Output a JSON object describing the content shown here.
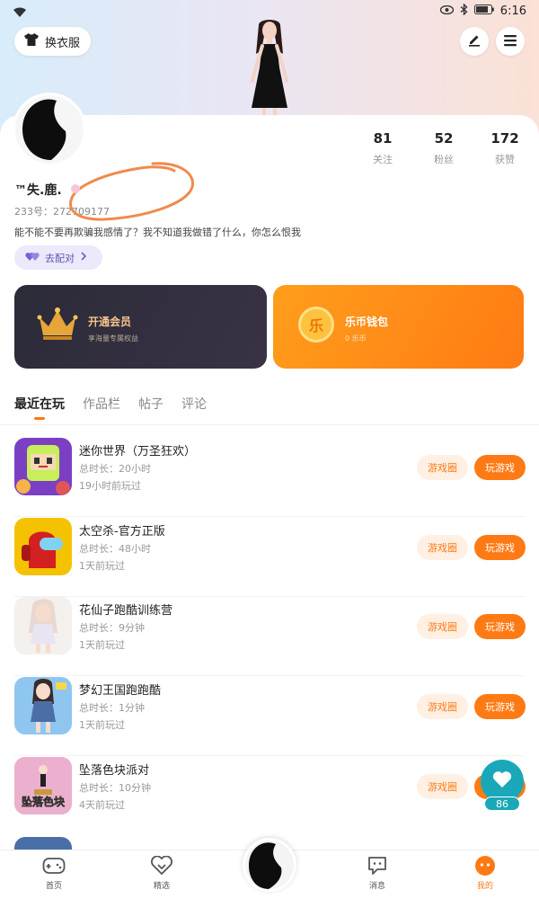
{
  "status_bar": {
    "time": "6:16"
  },
  "header": {
    "outfit_label": "换衣服"
  },
  "profile": {
    "stats": [
      {
        "value": "81",
        "label": "关注"
      },
      {
        "value": "52",
        "label": "粉丝"
      },
      {
        "value": "172",
        "label": "获赞"
      }
    ],
    "username": "™失.鹿.",
    "uid_prefix": "233号：",
    "uid_value": "272709177",
    "bio": "能不能不要再欺骗我感情了？我不知道我做错了什么，你怎么恨我",
    "match_label": "去配对"
  },
  "cards": {
    "vip": {
      "title": "开通会员",
      "subtitle": "享海量专属权益",
      "icon_char": ""
    },
    "wallet": {
      "title": "乐币钱包",
      "subtitle": "0 乐币",
      "icon_char": "乐"
    }
  },
  "tabs": [
    "最近在玩",
    "作品栏",
    "帖子",
    "评论"
  ],
  "games": [
    {
      "name": "迷你世界（万圣狂欢）",
      "duration": "总时长：20小时",
      "last_played": "19小时前玩过",
      "circle_label": "游戏圈",
      "play_label": "玩游戏"
    },
    {
      "name": "太空杀-官方正版",
      "duration": "总时长：48小时",
      "last_played": "1天前玩过",
      "circle_label": "游戏圈",
      "play_label": "玩游戏"
    },
    {
      "name": "花仙子跑酷训练营",
      "duration": "总时长：9分钟",
      "last_played": "1天前玩过",
      "circle_label": "游戏圈",
      "play_label": "玩游戏"
    },
    {
      "name": "梦幻王国跑跑酷",
      "duration": "总时长：1分钟",
      "last_played": "1天前玩过",
      "circle_label": "游戏圈",
      "play_label": "玩游戏"
    },
    {
      "name": "坠落色块派对",
      "duration": "总时长：10分钟",
      "last_played": "4天前玩过",
      "circle_label": "游戏圈",
      "play_label": "玩游戏",
      "icon_text": "坠落色块"
    }
  ],
  "like_count": "86",
  "bottom_nav": [
    {
      "label": "首页"
    },
    {
      "label": "精选"
    },
    {
      "label": "消息"
    },
    {
      "label": "我的"
    }
  ],
  "colors": {
    "accent": "#ff7a14",
    "accent_light": "#fff0e3",
    "match_purple": "#5b55b3",
    "like_teal": "#1aa8b8"
  }
}
